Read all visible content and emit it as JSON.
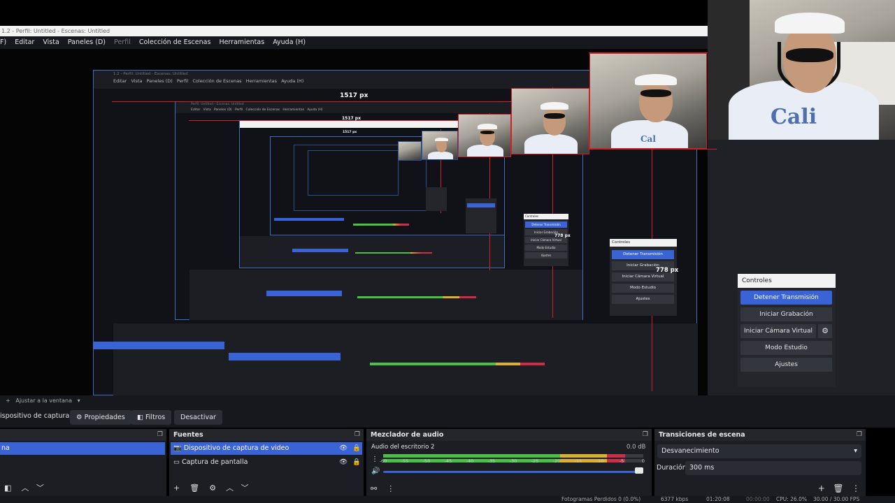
{
  "window": {
    "title": "1.2 - Perfil: Untitled - Escenas: Untitled"
  },
  "menu": {
    "items": [
      "F)",
      "Editar",
      "Vista",
      "Paneles (D)",
      "Perfil",
      "Colección de Escenas",
      "Herramientas",
      "Ayuda (H)"
    ]
  },
  "preview": {
    "width_label_1": "1517 px",
    "width_label_2": "1517 px",
    "width_label_3": "1517 px",
    "height_label_1": "778 px",
    "height_label_2": "778 px"
  },
  "controls": {
    "title": "Controles",
    "stop_stream": "Detener Transmisión",
    "start_recording": "Iniciar Grabación",
    "start_virtual_cam": "Iniciar Cámara Virtual",
    "studio_mode": "Modo Estudio",
    "settings": "Ajustes"
  },
  "toolbar": {
    "fit_label": "Ajustar a la ventana"
  },
  "context": {
    "source_name": "ispositivo de captura de v",
    "properties": "Propiedades",
    "filters": "Filtros",
    "deactivate": "Desactivar"
  },
  "scenes": {
    "selected_tail": "na"
  },
  "sources": {
    "title": "Fuentes",
    "items": [
      "Dispositivo de captura de video",
      "Captura de pantalla"
    ]
  },
  "mixer": {
    "title": "Mezclador de audio",
    "channel": "Audio del escritorio 2",
    "db": "0.0 dB",
    "ticks": [
      "-60",
      "-55",
      "-50",
      "-45",
      "-40",
      "-35",
      "-30",
      "-25",
      "-20",
      "-15",
      "-10",
      "-5",
      "0"
    ],
    "level": 0.93
  },
  "transitions": {
    "title": "Transiciones de escena",
    "selected": "Desvanecimiento",
    "duration_label": "Duración",
    "duration_value": "300 ms"
  },
  "status": {
    "dropped": "Fotogramas Perdidos 0 (0.0%)",
    "bitrate": "6377 kbps",
    "time1": "01:20:08",
    "time2": "00:00:00",
    "cpu": "CPU: 26.0%",
    "fps": "30.00 / 30.00 FPS"
  },
  "colors": {
    "accent": "#3a64d6",
    "guide": "#d0202a",
    "meter_green": "#4cbf4a",
    "meter_yellow": "#d9b030",
    "meter_red": "#c8304a"
  }
}
